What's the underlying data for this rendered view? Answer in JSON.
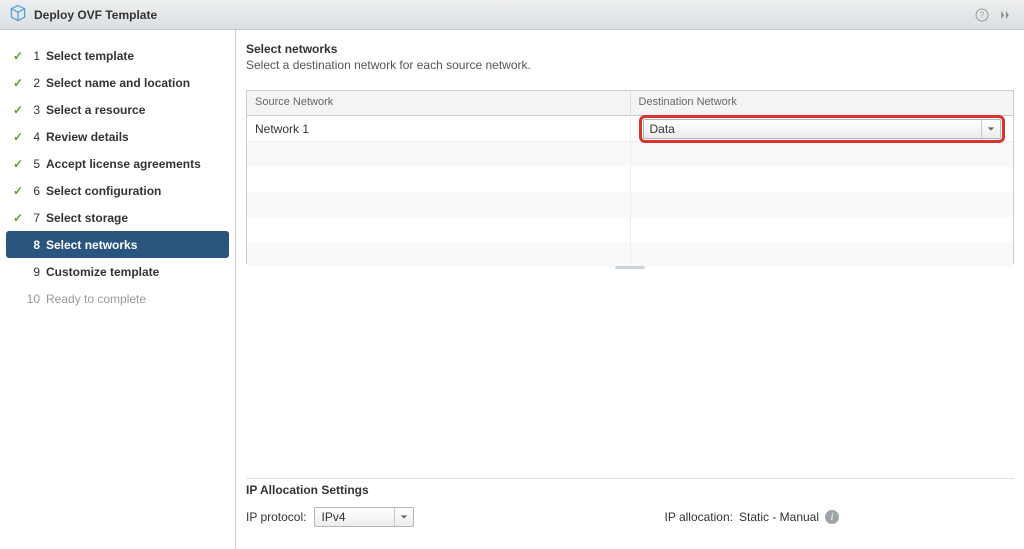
{
  "window": {
    "title": "Deploy OVF Template"
  },
  "steps": [
    {
      "num": "1",
      "label": "Select template",
      "state": "done"
    },
    {
      "num": "2",
      "label": "Select name and location",
      "state": "done"
    },
    {
      "num": "3",
      "label": "Select a resource",
      "state": "done"
    },
    {
      "num": "4",
      "label": "Review details",
      "state": "done"
    },
    {
      "num": "5",
      "label": "Accept license agreements",
      "state": "done"
    },
    {
      "num": "6",
      "label": "Select configuration",
      "state": "done"
    },
    {
      "num": "7",
      "label": "Select storage",
      "state": "done"
    },
    {
      "num": "8",
      "label": "Select networks",
      "state": "active"
    },
    {
      "num": "9",
      "label": "Customize template",
      "state": "normal"
    },
    {
      "num": "10",
      "label": "Ready to complete",
      "state": "disabled"
    }
  ],
  "page": {
    "title": "Select networks",
    "description": "Select a destination network for each source network."
  },
  "grid": {
    "columns": {
      "source": "Source Network",
      "destination": "Destination Network"
    },
    "rows": [
      {
        "source": "Network 1",
        "destination": "Data"
      }
    ]
  },
  "ip": {
    "section_title": "IP Allocation Settings",
    "protocol_label": "IP protocol:",
    "protocol_value": "IPv4",
    "allocation_label": "IP allocation:",
    "allocation_value": "Static - Manual"
  }
}
